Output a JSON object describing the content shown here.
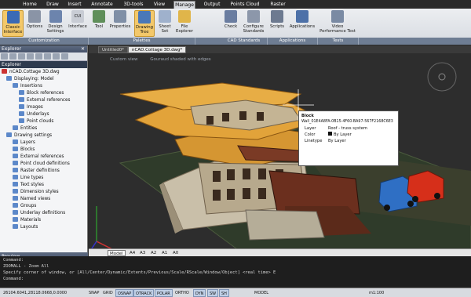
{
  "tabs": [
    "Home",
    "Draw",
    "Insert",
    "Annotate",
    "3D-tools",
    "View",
    "Manage",
    "Output",
    "Points Cloud",
    "Raster"
  ],
  "ribbon": {
    "buttons": [
      "Classic Interface",
      "Options",
      "Design Settings",
      "Interface",
      "Tool",
      "Properties",
      "Drawing Tree",
      "Sheet Set",
      "File Explorer",
      "Check",
      "Configure Standards",
      "Scripts",
      "Applications",
      "Video Performance Test"
    ],
    "groups": [
      "Customization",
      "Palettes",
      "CAD Standards",
      "Applications",
      "Tests"
    ],
    "interface_badge": "CUI"
  },
  "explorer": {
    "panel_title": "Explorer",
    "title": "Explorer",
    "items": [
      "nCAD.Cottage 3D.dwg",
      "Displaying: Model",
      "Insertions",
      "Block references",
      "External references",
      "Images",
      "Underlays",
      "Point clouds",
      "Entities",
      "Drawing settings",
      "Layers",
      "Blocks",
      "External references",
      "Point cloud definitions",
      "Raster definitions",
      "Line types",
      "Text styles",
      "Dimension styles",
      "Named views",
      "Groups",
      "Underlay definitions",
      "Materials",
      "Layouts"
    ]
  },
  "preview": {
    "title": "Preview"
  },
  "docs": {
    "tabs": [
      "Untitled0*",
      "nCAD.Cottage 3D.dwg*"
    ]
  },
  "viewport": {
    "view": "Custom view",
    "visual": "Gouraud shaded with edges"
  },
  "tooltip": {
    "title": "Block",
    "handle": "Wall_01E4A8FA-0B15-4F60-BA97-567F2168C6E3",
    "rows": [
      {
        "k": "Layer",
        "v": "Roof - truss system"
      },
      {
        "k": "Color",
        "v": "By Layer"
      },
      {
        "k": "Linetype",
        "v": "By Layer"
      }
    ]
  },
  "layout_tabs": [
    "Model",
    "A4",
    "A3",
    "A2",
    "A1",
    "A0"
  ],
  "command": {
    "lines": [
      "Command:",
      "ZOOMALL - Zoom All",
      "Specify corner of window, or [All/Center/Dynamic/Extents/Previous/Scale/RScale/Window/Object] <real time> E",
      "Command:"
    ]
  },
  "status": {
    "coords": "26104.6041,28118.0668,0.0000",
    "toggles": [
      "SNAP",
      "GRID",
      "OSNAP",
      "OTRACK",
      "POLAR",
      "ORTHO",
      "DYN",
      "SW",
      "SH"
    ],
    "model": "MODEL",
    "scale": "m1:100"
  },
  "colors": {
    "roof": "#e2a33a",
    "accent": "#f3c86a",
    "ribbon_group": "#6e7d93",
    "tree_header": "#46526a"
  }
}
